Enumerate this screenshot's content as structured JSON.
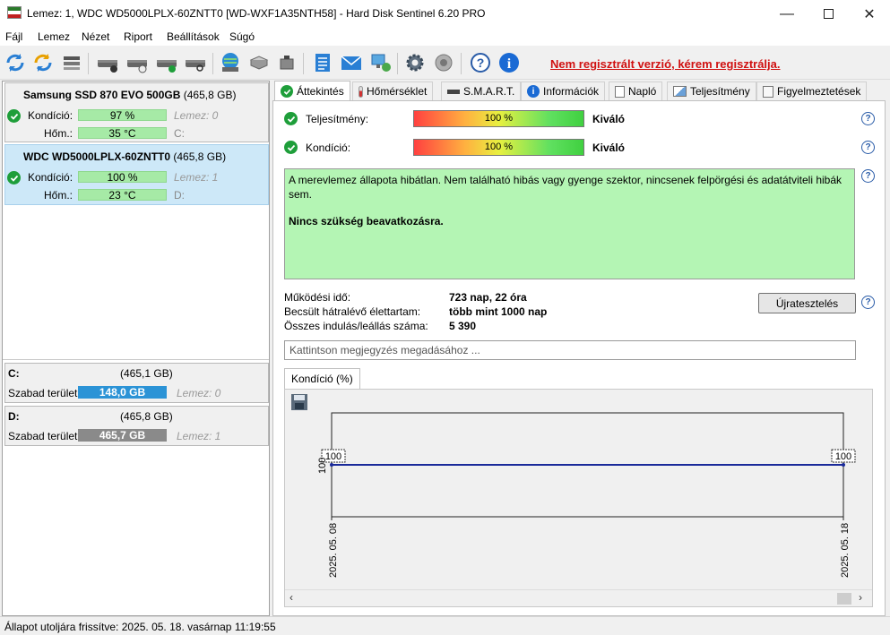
{
  "window": {
    "title": "Lemez: 1, WDC WD5000LPLX-60ZNTT0 [WD-WXF1A35NTH58]  -  Hard Disk Sentinel 6.20 PRO"
  },
  "menu": [
    "Fájl",
    "Lemez",
    "Nézet",
    "Riport",
    "Beállítások",
    "Súgó"
  ],
  "toolbar": {
    "unregistered": "Nem regisztrált verzió, kérem regisztrálja."
  },
  "disks": [
    {
      "name": "Samsung SSD 870 EVO 500GB",
      "size": "(465,8 GB)",
      "condition_label": "Kondíció:",
      "condition": "97 %",
      "condition_value": 97,
      "temp_label": "Hőm.:",
      "temp": "35 °C",
      "disk_label": "Lemez: 0",
      "drive": "C:"
    },
    {
      "name": "WDC WD5000LPLX-60ZNTT0",
      "size": "(465,8 GB)",
      "condition_label": "Kondíció:",
      "condition": "100 %",
      "condition_value": 100,
      "temp_label": "Hőm.:",
      "temp": "23 °C",
      "disk_label": "Lemez: 1",
      "drive": "D:"
    }
  ],
  "partitions": [
    {
      "drive": "C:",
      "size": "(465,1 GB)",
      "free_label": "Szabad terület",
      "free": "148,0 GB",
      "disk": "Lemez: 0"
    },
    {
      "drive": "D:",
      "size": "(465,8 GB)",
      "free_label": "Szabad terület",
      "free": "465,7 GB",
      "disk": "Lemez: 1"
    }
  ],
  "tabs": [
    "Áttekintés",
    "Hőmérséklet",
    "S.M.A.R.T.",
    "Információk",
    "Napló",
    "Teljesítmény",
    "Figyelmeztetések"
  ],
  "overview": {
    "performance_label": "Teljesítmény:",
    "performance": "100 %",
    "performance_rating": "Kiváló",
    "condition_label": "Kondíció:",
    "condition": "100 %",
    "condition_rating": "Kiváló",
    "status_text": "A merevlemez állapota hibátlan. Nem található hibás vagy gyenge szektor, nincsenek felpörgési és adatátviteli hibák sem.",
    "status_action": "Nincs szükség beavatkozásra.",
    "uptime_label": "Működési idő:",
    "uptime": "723 nap, 22 óra",
    "remaining_label": "Becsült hátralévő élettartam:",
    "remaining": "több mint 1000 nap",
    "starts_label": "Összes indulás/leállás száma:",
    "starts": "5 390",
    "retest_button": "Újratesztelés",
    "note_placeholder": "Kattintson megjegyzés megadásához ..."
  },
  "chart_tab": "Kondíció  (%)",
  "chart_data": {
    "type": "line",
    "x": [
      "2025. 05. 08",
      "2025. 05. 18"
    ],
    "series": [
      {
        "values": [
          100,
          100
        ]
      }
    ],
    "y_tick": "100",
    "point_labels": [
      "100",
      "100"
    ]
  },
  "status": "Állapot utoljára frissítve: 2025. 05. 18. vasárnap 11:19:55"
}
